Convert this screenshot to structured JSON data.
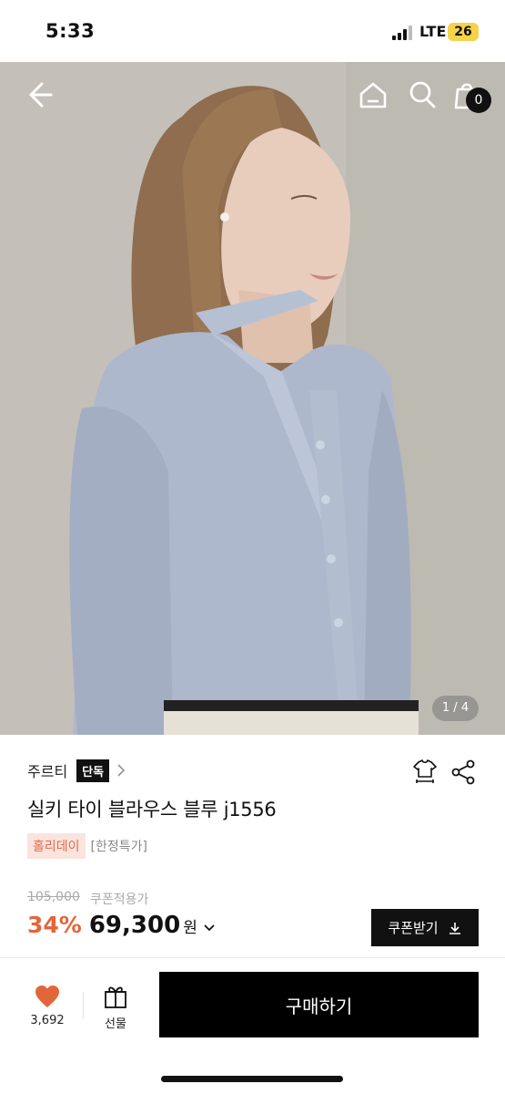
{
  "status_bar": {
    "time": "5:33",
    "network": "LTE",
    "battery": "26"
  },
  "header": {
    "cart_count": "0",
    "icons": [
      "back-arrow-icon",
      "home-icon",
      "search-icon",
      "cart-icon"
    ]
  },
  "gallery": {
    "indicator": "1 / 4"
  },
  "product": {
    "brand": "주르티",
    "brand_badge": "단독",
    "title": "실키 타이 블라우스 블루 j1556",
    "tag_event": "홀리데이",
    "tag_limited": "[한정특가]",
    "original_price": "105,000",
    "coupon_label": "쿠폰적용가",
    "discount": "34%",
    "price": "69,300",
    "currency": "원",
    "coupon_button": "쿠폰받기"
  },
  "bottom_bar": {
    "like_count": "3,692",
    "gift_label": "선물",
    "buy_button": "구매하기"
  },
  "colors": {
    "accent": "#e2653b",
    "tag_bg": "#fbe4de",
    "primary": "#000000"
  }
}
